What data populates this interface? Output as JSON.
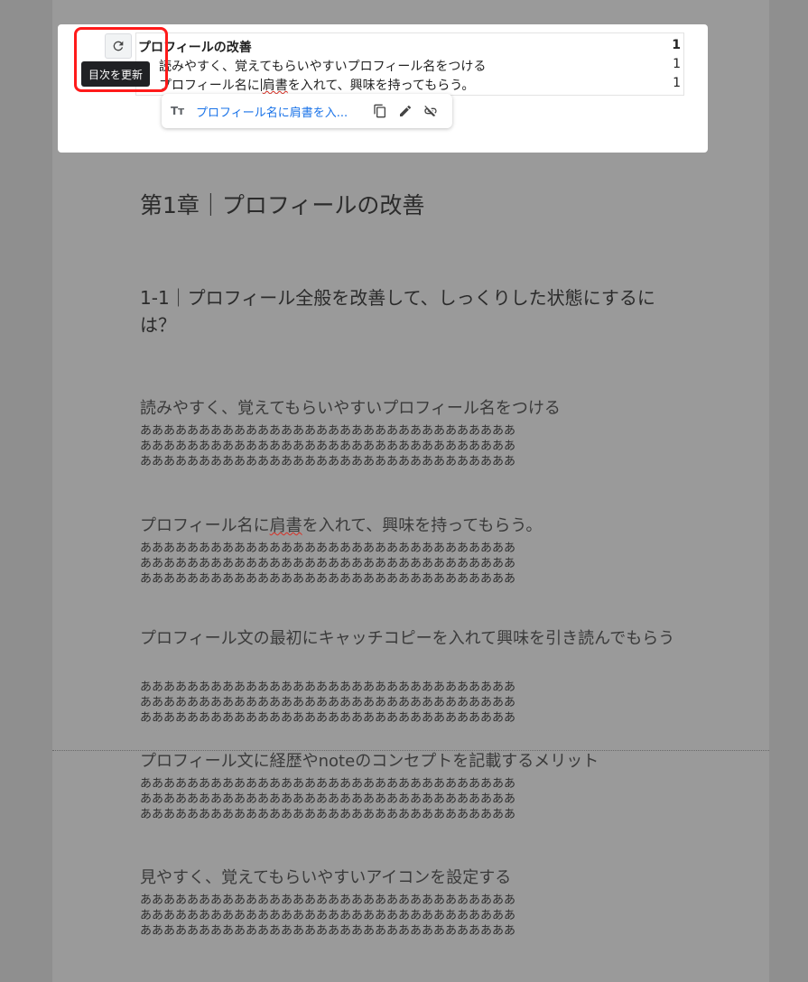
{
  "toc": {
    "rows": [
      {
        "title": "プロフィールの改善",
        "page": "1"
      },
      {
        "title": "読みやすく、覚えてもらいやすいプロフィール名をつける",
        "page": "1"
      },
      {
        "title_pre": "プロフィール名に",
        "title_spell": "肩書",
        "title_post": "を入れて、興味を持ってもらう。",
        "page": "1"
      }
    ],
    "refresh_tooltip": "目次を更新"
  },
  "link_bubble": {
    "text_icon": "Tт",
    "link_text": "プロフィール名に肩書を入...",
    "icons": [
      "copy-icon",
      "edit-icon",
      "unlink-icon"
    ]
  },
  "document": {
    "chapter_heading": "第1章｜プロフィールの改善",
    "section_heading": "1-1｜プロフィール全般を改善して、しっくりした状態にするには？",
    "subsections": [
      {
        "heading": "読みやすく、覚えてもらいやすいプロフィール名をつける",
        "lines": [
          "ああああああああああああああああああああああああああああああああ",
          "ああああああああああああああああああああああああああああああああ",
          "ああああああああああああああああああああああああああああああああ"
        ]
      },
      {
        "heading_pre": "プロフィール名に",
        "heading_spell": "肩書",
        "heading_post": "を入れて、興味を持ってもらう。",
        "lines": [
          "ああああああああああああああああああああああああああああああああ",
          "ああああああああああああああああああああああああああああああああ",
          "ああああああああああああああああああああああああああああああああ"
        ]
      },
      {
        "heading": "プロフィール文の最初にキャッチコピーを入れて興味を引き読んでもらう",
        "lines": [
          "ああああああああああああああああああああああああああああああああ",
          "ああああああああああああああああああああああああああああああああ",
          "ああああああああああああああああああああああああああああああああ"
        ]
      },
      {
        "heading": "プロフィール文に経歴やnoteのコンセプトを記載するメリット",
        "lines": [
          "ああああああああああああああああああああああああああああああああ",
          "ああああああああああああああああああああああああああああああああ",
          "ああああああああああああああああああああああああああああああああ"
        ]
      },
      {
        "heading": "見やすく、覚えてもらいやすいアイコンを設定する",
        "lines": [
          "ああああああああああああああああああああああああああああああああ",
          "ああああああああああああああああああああああああああああああああ",
          "ああああああああああああああああああああああああああああああああ"
        ]
      }
    ]
  },
  "colors": {
    "highlight": "#ff1a1a",
    "link": "#1a73e8",
    "tooltip_bg": "#202124"
  }
}
